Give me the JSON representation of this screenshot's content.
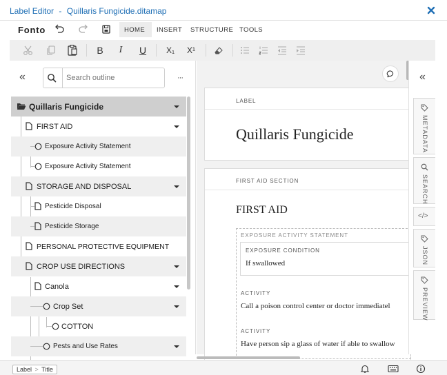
{
  "window": {
    "app_title": "Label Editor",
    "separator": "-",
    "file_name": "Quillaris Fungicide.ditamap",
    "close_glyph": "✕"
  },
  "menubar": {
    "logo": "Fonto",
    "tabs": [
      "HOME",
      "INSERT",
      "STRUCTURE",
      "TOOLS"
    ],
    "active_tab": "HOME"
  },
  "toolbar": {
    "bold": "B",
    "italic": "I",
    "underline": "U",
    "subscript": "X₁",
    "superscript": "X¹"
  },
  "outline": {
    "collapse_glyph": "«",
    "more_glyph": "···",
    "search_placeholder": "Search outline",
    "items": [
      {
        "label": "Quillaris Fungicide"
      },
      {
        "label": "FIRST AID"
      },
      {
        "label": "Exposure Activity Statement"
      },
      {
        "label": "Exposure Activity Statement"
      },
      {
        "label": "STORAGE AND DISPOSAL"
      },
      {
        "label": "Pesticide Disposal"
      },
      {
        "label": "Pesticide Storage"
      },
      {
        "label": "PERSONAL PROTECTIVE EQUIPMENT"
      },
      {
        "label": "CROP USE DIRECTIONS"
      },
      {
        "label": "Canola"
      },
      {
        "label": "Crop Set"
      },
      {
        "label": "COTTON"
      },
      {
        "label": "Pests and Use Rates"
      }
    ]
  },
  "document": {
    "label_caption": "LABEL",
    "label_title": "Quillaris Fungicide",
    "section_caption": "FIRST AID SECTION",
    "section_title": "FIRST AID",
    "exposure_caption": "EXPOSURE ACTIVITY STATEMENT",
    "condition_caption": "EXPOSURE CONDITION",
    "condition_text": "If swallowed",
    "activity_caption_1": "ACTIVITY",
    "activity_text_1": "Call a poison control center or doctor immediatel",
    "activity_caption_2": "ACTIVITY",
    "activity_text_2": "Have person sip a glass of water if able to swallow"
  },
  "sidepanel": {
    "collapse_glyph": "«",
    "tabs": [
      "METADATA",
      "SEARCH",
      "</>",
      "JSON",
      "PREVIEW"
    ]
  },
  "statusbar": {
    "breadcrumb": [
      "Label",
      "Title"
    ],
    "breadcrumb_sep": ">"
  }
}
